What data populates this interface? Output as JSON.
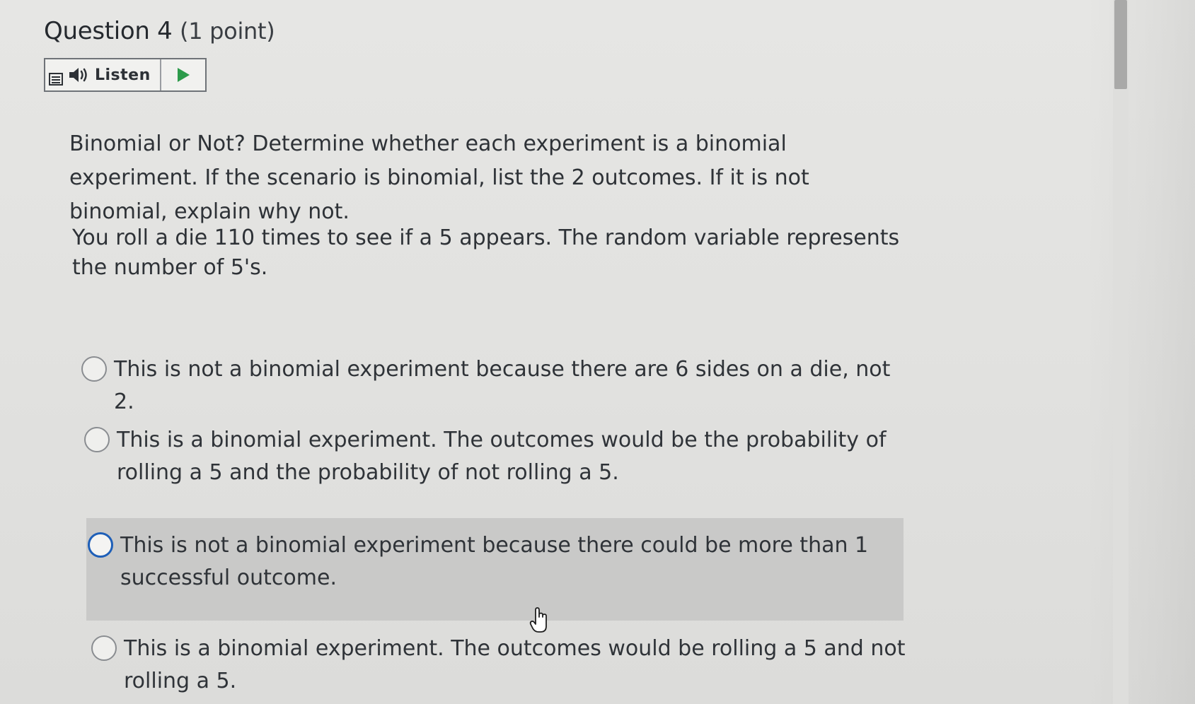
{
  "question": {
    "title": "Question 4",
    "points": "(1 point)"
  },
  "listen": {
    "label": "Listen",
    "menu_icon": "menu-lines-icon",
    "speaker_icon": "speaker-icon",
    "play_icon": "play-icon"
  },
  "prompt": "Binomial or Not? Determine whether each experiment is a binomial experiment. If the scenario is binomial, list the 2 outcomes. If it is not binomial, explain why not.",
  "scenario": "You roll a die 110 times to see if a 5 appears. The random variable represents the number of 5's.",
  "options": [
    {
      "label": "This is not a binomial experiment because there are 6 sides on a die, not 2."
    },
    {
      "label": "This is a binomial experiment. The outcomes would be the probability of rolling a 5 and the probability of not rolling a 5."
    },
    {
      "label": "This is not a binomial experiment because there could be more than 1 successful outcome."
    },
    {
      "label": "This is a binomial experiment. The outcomes would be rolling a 5 and not rolling a 5."
    }
  ],
  "colors": {
    "hover_radio": "#1e5fb8",
    "hover_background": "#c9c9c8",
    "page_background": "#e3e3e1"
  }
}
